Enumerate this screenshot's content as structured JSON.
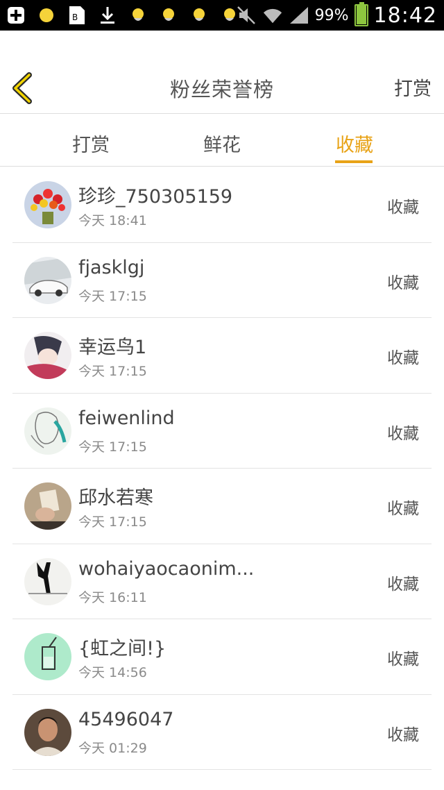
{
  "status_bar": {
    "battery_pct": "99%",
    "time": "18:42",
    "colors": {
      "battery": "#8ec63f",
      "background": "#000000"
    }
  },
  "header": {
    "title": "粉丝荣誉榜",
    "right_link": "打赏"
  },
  "tabs": [
    {
      "label": "打赏",
      "active": false
    },
    {
      "label": "鲜花",
      "active": false
    },
    {
      "label": "收藏",
      "active": true
    }
  ],
  "accent_color": "#e8a317",
  "rows": [
    {
      "name": "珍珍_750305159",
      "time": "今天 18:41",
      "action": "收藏",
      "avatar": "flowers"
    },
    {
      "name": "fjasklgj",
      "time": "今天 17:15",
      "action": "收藏",
      "avatar": "car"
    },
    {
      "name": "幸运鸟1",
      "time": "今天 17:15",
      "action": "收藏",
      "avatar": "anime"
    },
    {
      "name": "feiwenlind",
      "time": "今天 17:15",
      "action": "收藏",
      "avatar": "sketch"
    },
    {
      "name": "邱水若寒",
      "time": "今天 17:15",
      "action": "收藏",
      "avatar": "photo"
    },
    {
      "name": "wohaiyaocaonim...",
      "time": "今天 16:11",
      "action": "收藏",
      "avatar": "dancer"
    },
    {
      "name": "{虹之间!}",
      "time": "今天 14:56",
      "action": "收藏",
      "avatar": "drink"
    },
    {
      "name": "45496047",
      "time": "今天 01:29",
      "action": "收藏",
      "avatar": "man"
    }
  ]
}
